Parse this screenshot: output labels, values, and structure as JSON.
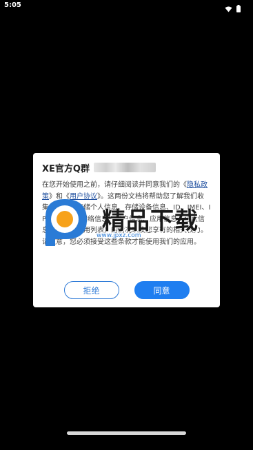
{
  "status_bar": {
    "time": "5:05"
  },
  "dialog": {
    "title": "XE官方Q群",
    "body_before_link1": "在您开始使用之前，请仔细阅读并同意我们的《",
    "link1_text": "隐私政策",
    "body_between_links": "》和《",
    "link2_text": "用户协议",
    "body_after_links": "》。这两份文档将帮助您了解我们收集、使用、存储个人信息、存储设备信息、ID、IMEI、IP位置信息、网络信息、用户信息、应用信息、位置信息、已安装应用列表）的情况以及您享有的相关权力。请注意，您必须接受这些条款才能使用我们的应用。",
    "reject_label": "拒绝",
    "accept_label": "同意"
  },
  "watermark": {
    "logo_text": "精品下载",
    "url": "www.jpxz.com"
  },
  "colors": {
    "background": "#000000",
    "accent": "#1f7ef0",
    "link": "#1f4f9f"
  }
}
